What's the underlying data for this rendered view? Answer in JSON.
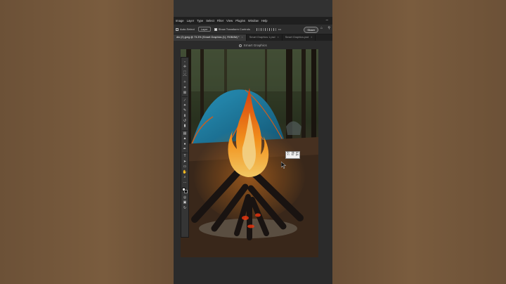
{
  "menu": [
    "Image",
    "Layer",
    "Type",
    "Select",
    "Filter",
    "View",
    "Plugins",
    "Window",
    "Help"
  ],
  "options": {
    "auto_select_label": "Auto-Select",
    "layer_dropdown": "Layer",
    "show_transform_label": "Show Transform Controls",
    "more_label": "•••",
    "share_label": "Share"
  },
  "tabs": [
    {
      "label": "dio (2).jpeg @ 73.3% (Smart Graphics (1), RGB/8#) *",
      "active": true
    },
    {
      "label": "Smart Graphics 1.psd",
      "active": false
    },
    {
      "label": "Smart Graphics.psd",
      "active": false
    }
  ],
  "tab_close": "×",
  "canvas_title": "Smart Graphics",
  "hud": {
    "line1": "X: 36 px",
    "line2": "Y: 67 px"
  },
  "toolbar_header": "»",
  "tools": [
    {
      "name": "move-tool-icon",
      "glyph": "✛"
    },
    {
      "name": "marquee-tool-icon",
      "glyph": "⬚"
    },
    {
      "name": "lasso-tool-icon",
      "glyph": "⌒"
    },
    {
      "name": "magic-wand-tool-icon",
      "glyph": "✧"
    },
    {
      "name": "crop-tool-icon",
      "glyph": "⌗"
    },
    {
      "name": "frame-tool-icon",
      "glyph": "⊠"
    },
    {
      "name": "eyedropper-tool-icon",
      "glyph": "∕"
    },
    {
      "name": "healing-brush-tool-icon",
      "glyph": "✦"
    },
    {
      "name": "brush-tool-icon",
      "glyph": "✎"
    },
    {
      "name": "clone-stamp-tool-icon",
      "glyph": "⬇"
    },
    {
      "name": "history-brush-tool-icon",
      "glyph": "↺"
    },
    {
      "name": "eraser-tool-icon",
      "glyph": "▮"
    },
    {
      "name": "gradient-tool-icon",
      "glyph": "▤"
    },
    {
      "name": "blur-tool-icon",
      "glyph": "▲"
    },
    {
      "name": "dodge-tool-icon",
      "glyph": "●"
    },
    {
      "name": "pen-tool-icon",
      "glyph": "✒"
    },
    {
      "name": "type-tool-icon",
      "glyph": "T"
    },
    {
      "name": "path-selection-tool-icon",
      "glyph": "➤"
    },
    {
      "name": "rectangle-tool-icon",
      "glyph": "▭"
    },
    {
      "name": "hand-tool-icon",
      "glyph": "✋"
    },
    {
      "name": "zoom-tool-icon",
      "glyph": "⌕"
    },
    {
      "name": "more-tools-icon",
      "glyph": "…"
    }
  ],
  "bottom_tools": [
    {
      "name": "quick-mask-icon",
      "glyph": "◎"
    },
    {
      "name": "screen-mode-icon",
      "glyph": "▣"
    },
    {
      "name": "edit-toolbar-icon",
      "glyph": "↻"
    }
  ],
  "colors": {
    "app_bg": "#2b2b2b",
    "menubar": "#1f1f1f",
    "accent_flame": "#ff8a1e",
    "tent": "#1f7fa6"
  }
}
